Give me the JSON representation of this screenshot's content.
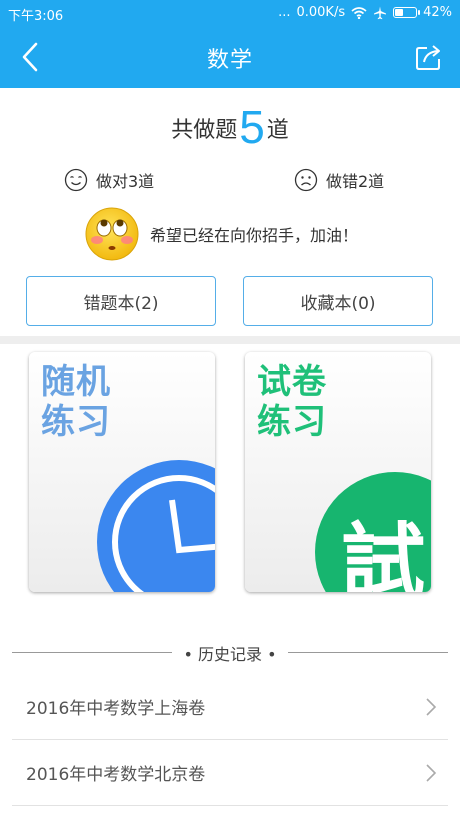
{
  "status_bar": {
    "time": "下午3:06",
    "signal": "...",
    "speed": "0.00K/s",
    "battery": "42%",
    "battery_level": 0.42
  },
  "header": {
    "title": "数学"
  },
  "summary": {
    "prefix": "共做题",
    "count": "5",
    "suffix": "道"
  },
  "results": {
    "correct": "做对3道",
    "wrong": "做错2道"
  },
  "encouragement": "希望已经在向你招手，加油！",
  "buttons": {
    "mistakes": "错题本(2)",
    "favorites": "收藏本(0)"
  },
  "cards": {
    "random": {
      "line1": "随机",
      "line2": "练习",
      "color": "#6aa3e2",
      "emblem_color": "#3b87ef"
    },
    "exam": {
      "line1": "试卷",
      "line2": "练习",
      "color": "#1fc079",
      "emblem_color": "#17b56f",
      "emblem_char": "試"
    }
  },
  "history": {
    "title": "历史记录",
    "items": [
      {
        "label": "2016年中考数学上海卷"
      },
      {
        "label": "2016年中考数学北京卷"
      }
    ]
  },
  "colors": {
    "brand": "#21a9f0"
  }
}
